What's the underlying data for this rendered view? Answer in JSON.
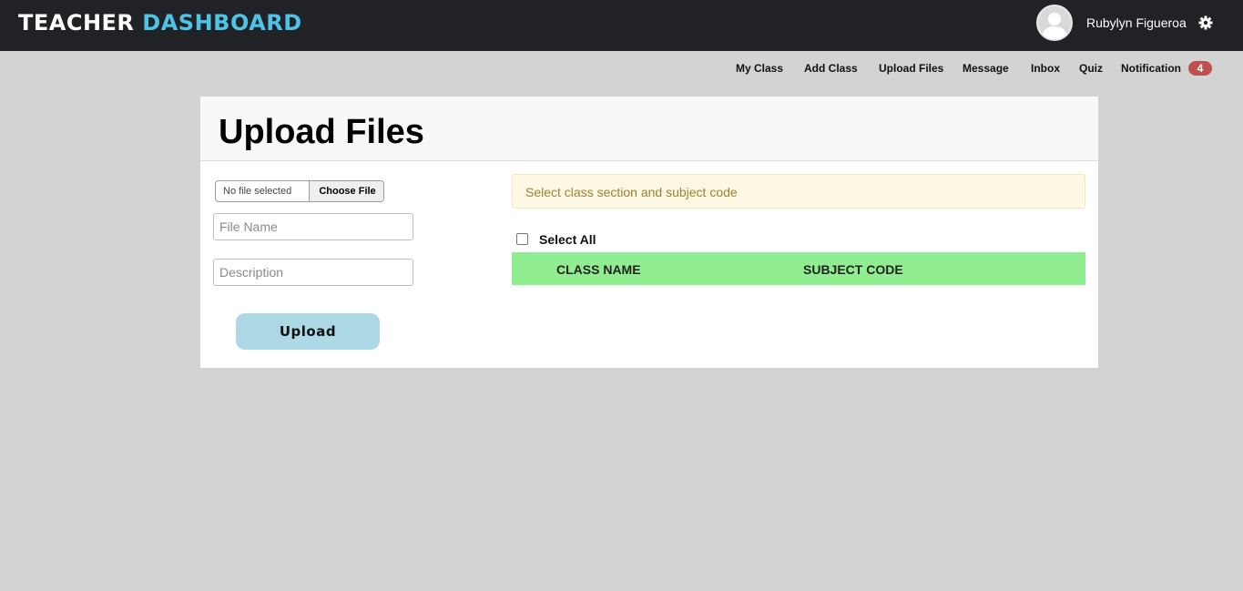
{
  "header": {
    "brand_part1": "TEACHER",
    "brand_part2": "DASHBOARD",
    "username": "Rubylyn Figueroa",
    "avatar_icon": "user-avatar-icon",
    "settings_icon": "gear-icon"
  },
  "nav": {
    "my_class": "My Class",
    "add_class": "Add Class",
    "upload_files": "Upload Files",
    "message": "Message",
    "inbox": "Inbox",
    "quiz": "Quiz",
    "notification": "Notification",
    "notification_count": "4"
  },
  "page": {
    "title": "Upload Files"
  },
  "form": {
    "file_status": "No file selected",
    "choose_file_label": "Choose File",
    "file_name_placeholder": "File Name",
    "description_placeholder": "Description",
    "upload_label": "Upload"
  },
  "classes": {
    "alert_text": "Select class section and subject code",
    "select_all_label": "Select All",
    "columns": [
      "CLASS NAME",
      "SUBJECT CODE"
    ]
  },
  "colors": {
    "topbar": "#212226",
    "brand_accent": "#4ec3e8",
    "upload_button": "#add8e6",
    "table_header": "#90ee90",
    "badge": "#c0504d",
    "alert_bg": "#fcf8e3"
  }
}
